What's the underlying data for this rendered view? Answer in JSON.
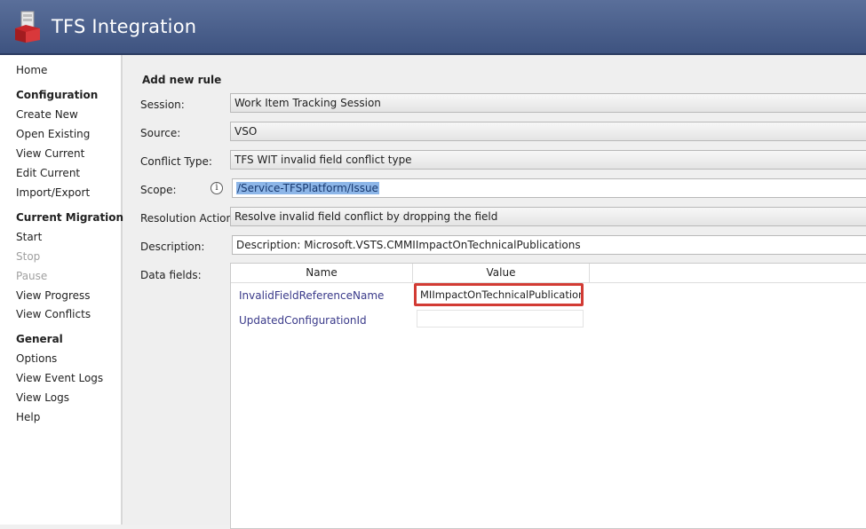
{
  "app": {
    "title": "TFS Integration"
  },
  "sidebar": {
    "home": "Home",
    "configuration": {
      "heading": "Configuration",
      "items": [
        "Create New",
        "Open Existing",
        "View Current",
        "Edit Current",
        "Import/Export"
      ]
    },
    "current_migration": {
      "heading": "Current Migration",
      "items": [
        "Start",
        "Stop",
        "Pause",
        "View Progress",
        "View Conflicts"
      ]
    },
    "general": {
      "heading": "General",
      "items": [
        "Options",
        "View Event Logs",
        "View Logs",
        "Help"
      ]
    }
  },
  "form": {
    "title": "Add new rule",
    "session": {
      "label": "Session:",
      "value": "Work Item Tracking Session"
    },
    "source": {
      "label": "Source:",
      "value": "VSO"
    },
    "conflict_type": {
      "label": "Conflict Type:",
      "value": "TFS WIT invalid field conflict type"
    },
    "scope": {
      "label": "Scope:",
      "value": "/Service-TFSPlatform/Issue"
    },
    "resolution_action": {
      "label": "Resolution Action:",
      "value": "Resolve invalid field conflict by dropping the field"
    },
    "description": {
      "label": "Description:",
      "value": "Description: Microsoft.VSTS.CMMIImpactOnTechnicalPublications"
    },
    "data_fields": {
      "label": "Data fields:",
      "columns": {
        "name": "Name",
        "value": "Value"
      },
      "rows": [
        {
          "name": "InvalidFieldReferenceName",
          "value": "MIImpactOnTechnicalPublications"
        },
        {
          "name": "UpdatedConfigurationId",
          "value": ""
        }
      ]
    }
  },
  "colors": {
    "titlebar": "#4a5f8c",
    "highlight_border": "#d23b34",
    "selection": "#8db6e8"
  }
}
